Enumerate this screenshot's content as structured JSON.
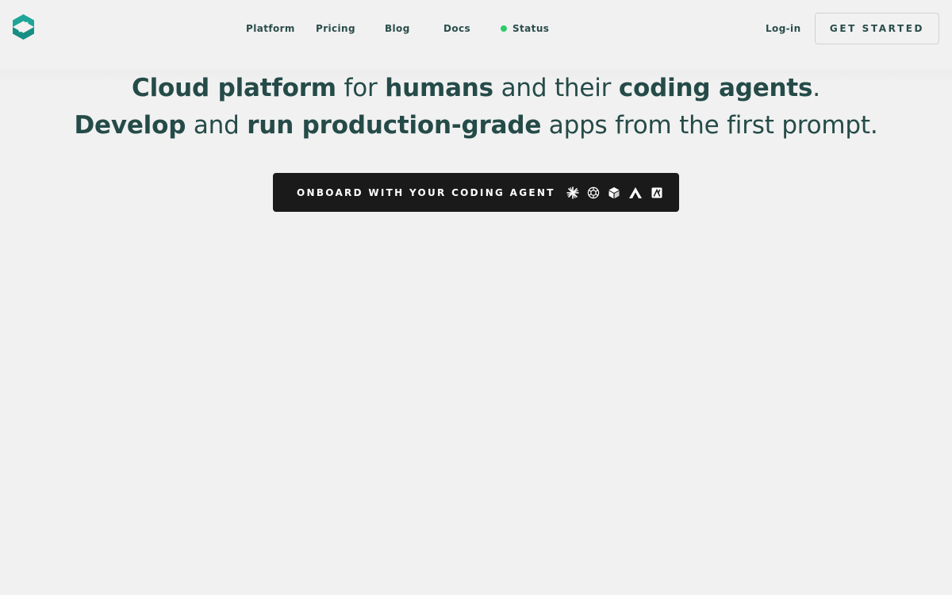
{
  "nav": {
    "links": [
      {
        "label": "Platform"
      },
      {
        "label": "Pricing"
      },
      {
        "label": "Blog"
      },
      {
        "label": "Docs"
      },
      {
        "label": "Status"
      }
    ],
    "login_label": "Log-in",
    "get_started_label": "GET STARTED",
    "status_color": "#2fcb6a"
  },
  "hero": {
    "line1": {
      "p1": "Cloud platform",
      "p2": " for ",
      "p3": "humans",
      "p4": " and their ",
      "p5": "coding agents",
      "p6": "."
    },
    "line2": {
      "p1": "Develop",
      "p2": " and ",
      "p3": "run production-grade",
      "p4": " apps from the first prompt."
    },
    "text_color": "#254b48"
  },
  "cta": {
    "label": "ONBOARD WITH YOUR CODING AGENT",
    "icons": [
      "sparkle-icon",
      "openai-knot-icon",
      "cube-icon",
      "peak-icon",
      "square-glyph-icon"
    ]
  },
  "brand": {
    "accent": "#1ea597"
  }
}
